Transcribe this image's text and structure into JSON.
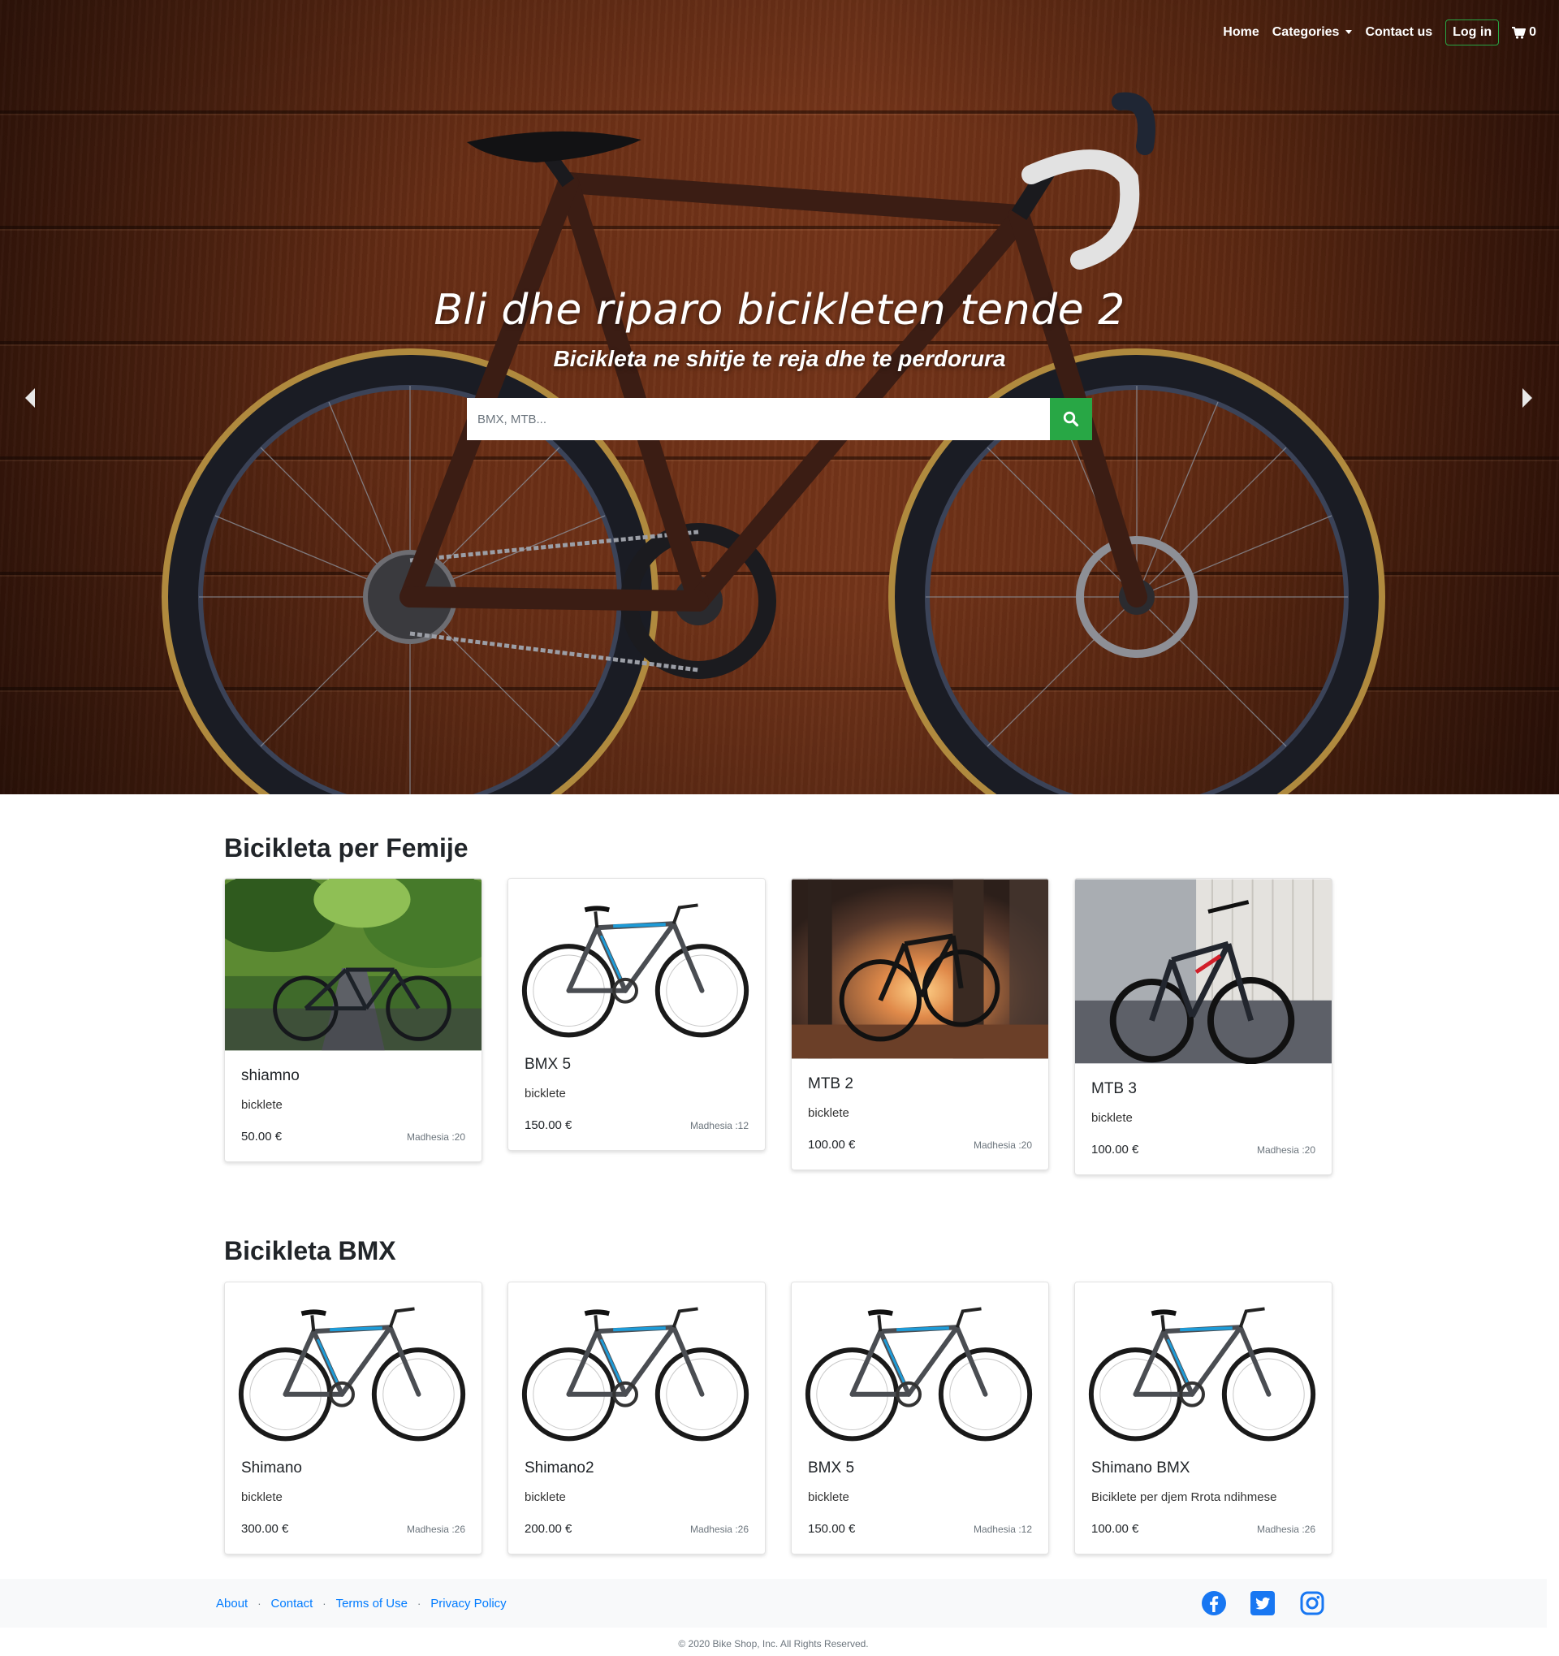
{
  "nav": {
    "home": "Home",
    "categories": "Categories",
    "contact": "Contact us",
    "login": "Log in",
    "cart_count": "0"
  },
  "hero": {
    "title": "Bli dhe riparo bicikleten tende 2",
    "subtitle": "Bicikleta ne shitje te reja dhe te perdorura",
    "search_placeholder": "BMX, MTB..."
  },
  "sections": [
    {
      "title": "Bicikleta per Femije",
      "products": [
        {
          "name": "shiamno",
          "desc": "bicklete",
          "price": "50.00 €",
          "size": "Madhesia :20",
          "image": "park-road-bike-photo"
        },
        {
          "name": "BMX 5",
          "desc": "bicklete",
          "price": "150.00 €",
          "size": "Madhesia :12",
          "image": "studio-bike-photo"
        },
        {
          "name": "MTB 2",
          "desc": "bicklete",
          "price": "100.00 €",
          "size": "Madhesia :20",
          "image": "sunset-bike-photo"
        },
        {
          "name": "MTB 3",
          "desc": "bicklete",
          "price": "100.00 €",
          "size": "Madhesia :20",
          "image": "street-mtb-photo"
        }
      ]
    },
    {
      "title": "Bicikleta BMX",
      "products": [
        {
          "name": "Shimano",
          "desc": "bicklete",
          "price": "300.00 €",
          "size": "Madhesia :26",
          "image": "studio-bike-photo"
        },
        {
          "name": "Shimano2",
          "desc": "bicklete",
          "price": "200.00 €",
          "size": "Madhesia :26",
          "image": "studio-bike-photo"
        },
        {
          "name": "BMX 5",
          "desc": "bicklete",
          "price": "150.00 €",
          "size": "Madhesia :12",
          "image": "studio-bike-photo"
        },
        {
          "name": "Shimano BMX",
          "desc": "Biciklete per djem Rrota ndihmese",
          "price": "100.00 €",
          "size": "Madhesia :26",
          "image": "studio-bike-photo"
        }
      ]
    }
  ],
  "footer": {
    "links": [
      "About",
      "Contact",
      "Terms of Use",
      "Privacy Policy"
    ],
    "copyright": "© 2020 Bike Shop, Inc. All Rights Reserved."
  },
  "icons": {
    "search": "search-icon",
    "cart": "cart-icon",
    "prev": "chevron-left-icon",
    "next": "chevron-right-icon",
    "facebook": "facebook-icon",
    "twitter": "twitter-icon",
    "instagram": "instagram-icon"
  },
  "colors": {
    "accent_green": "#28a745",
    "link_blue": "#007bff",
    "social_blue": "#1877f2",
    "hero_wood": "#6a2f16"
  }
}
